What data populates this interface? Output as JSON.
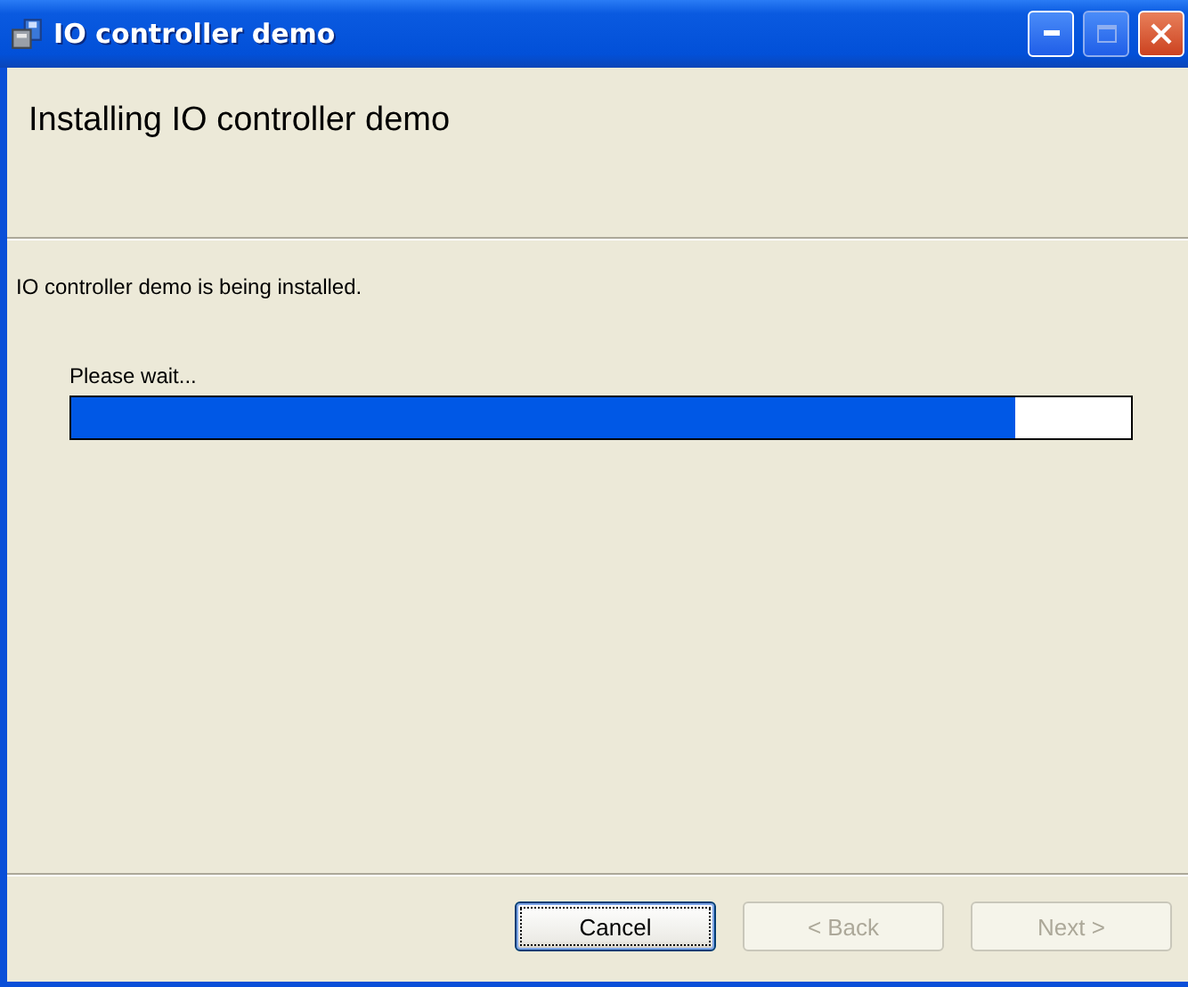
{
  "window": {
    "title": "IO controller demo",
    "maximize_disabled": true
  },
  "header": {
    "title": "Installing IO controller demo"
  },
  "message": "IO controller demo is being installed.",
  "progress": {
    "label": "Please wait...",
    "level": 0.89
  },
  "buttons": [
    {
      "label": "Cancel",
      "disabled": false,
      "default": true
    },
    {
      "label": "< Back",
      "disabled": true,
      "default": false
    },
    {
      "label": "Next >",
      "disabled": true,
      "default": false
    }
  ]
}
